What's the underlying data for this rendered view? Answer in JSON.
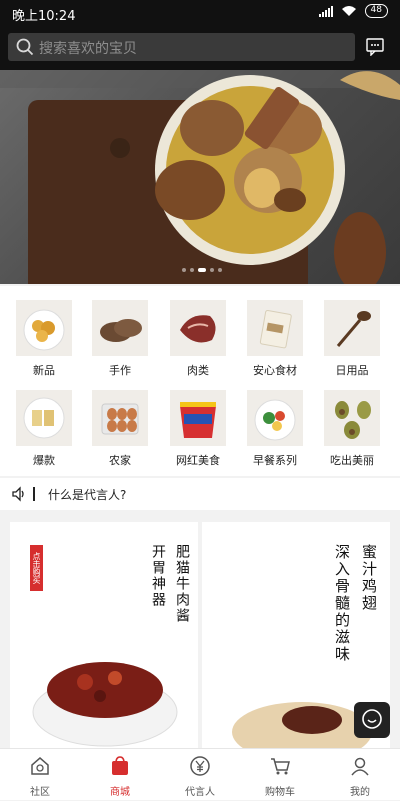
{
  "status": {
    "time": "晚上10:24",
    "battery": "48"
  },
  "search": {
    "placeholder": "搜索喜欢的宝贝"
  },
  "categories": [
    {
      "label": "新品",
      "icon": "corn-snack-icon"
    },
    {
      "label": "手作",
      "icon": "sliced-beef-icon"
    },
    {
      "label": "肉类",
      "icon": "meat-icon"
    },
    {
      "label": "安心食材",
      "icon": "flour-bag-icon"
    },
    {
      "label": "日用品",
      "icon": "wooden-spoon-icon"
    },
    {
      "label": "爆款",
      "icon": "tofu-plate-icon"
    },
    {
      "label": "农家",
      "icon": "egg-box-icon"
    },
    {
      "label": "网红美食",
      "icon": "snack-cup-icon"
    },
    {
      "label": "早餐系列",
      "icon": "salad-bowl-icon"
    },
    {
      "label": "吃出美丽",
      "icon": "avocado-icon"
    }
  ],
  "notice": {
    "text": "什么是代言人?"
  },
  "promos": [
    {
      "tag": "点击购买",
      "line1": "开胃神器",
      "line2": "肥猫牛肉酱"
    },
    {
      "line1": "深入骨髓的滋味",
      "line2": "蜜汁鸡翅"
    }
  ],
  "tabs": [
    {
      "label": "社区",
      "icon": "community-home-icon"
    },
    {
      "label": "商城",
      "icon": "shopping-bag-icon",
      "active": true
    },
    {
      "label": "代言人",
      "icon": "yen-coin-icon"
    },
    {
      "label": "购物车",
      "icon": "shopping-cart-icon"
    },
    {
      "label": "我的",
      "icon": "user-profile-icon"
    }
  ],
  "colors": {
    "accent": "#d62e2e",
    "topbar": "#111111"
  }
}
